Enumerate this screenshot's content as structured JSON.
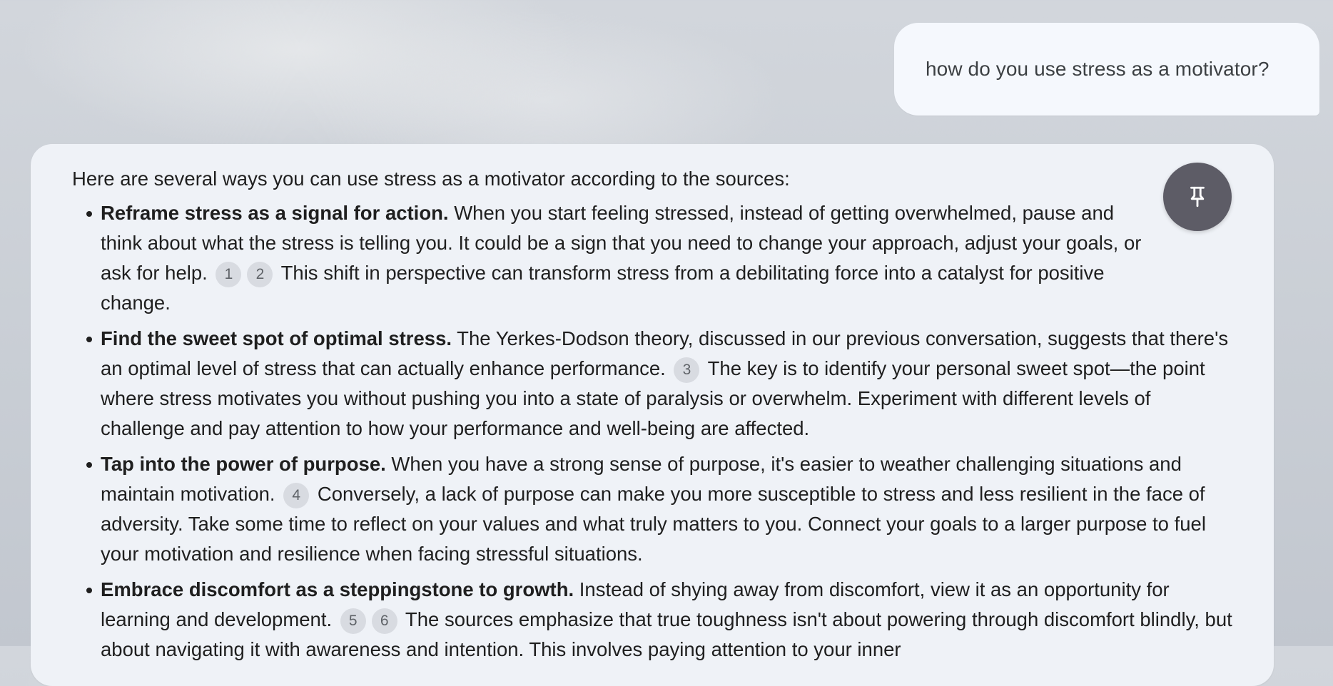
{
  "user_message": {
    "text": "how do you use stress as a motivator?"
  },
  "response": {
    "intro": "Here are several ways you can use stress as a motivator according to the sources:",
    "points": [
      {
        "lead": "Reframe stress as a signal for action.",
        "text_a": " When you start feeling stressed, instead of getting overwhelmed, pause and think about what the stress is telling you. It could be a sign that you need to change your approach, adjust your goals, or ask for help.",
        "cites": [
          "1",
          "2"
        ],
        "text_b": "This shift in perspective can transform stress from a debilitating force into a catalyst for positive change."
      },
      {
        "lead": "Find the sweet spot of optimal stress.",
        "text_a": " The Yerkes-Dodson theory, discussed in our previous conversation, suggests that there's an optimal level of stress that can actually enhance performance.",
        "cites": [
          "3"
        ],
        "text_b": "The key is to identify your personal sweet spot—the point where stress motivates you without pushing you into a state of paralysis or overwhelm. Experiment with different levels of challenge and pay attention to how your performance and well-being are affected."
      },
      {
        "lead": "Tap into the power of purpose.",
        "text_a": " When you have a strong sense of purpose, it's easier to weather challenging situations and maintain motivation.",
        "cites": [
          "4"
        ],
        "text_b": "Conversely, a lack of purpose can make you more susceptible to stress and less resilient in the face of adversity. Take some time to reflect on your values and what truly matters to you. Connect your goals to a larger purpose to fuel your motivation and resilience when facing stressful situations."
      },
      {
        "lead": "Embrace discomfort as a steppingstone to growth.",
        "text_a": " Instead of shying away from discomfort, view it as an opportunity for learning and development.",
        "cites": [
          "5",
          "6"
        ],
        "text_b": "The sources emphasize that true toughness isn't about powering through discomfort blindly, but about navigating it with awareness and intention. This involves paying attention to your inner"
      }
    ]
  },
  "pin_button": {
    "icon": "pin-icon",
    "color": "#5d5c66"
  }
}
